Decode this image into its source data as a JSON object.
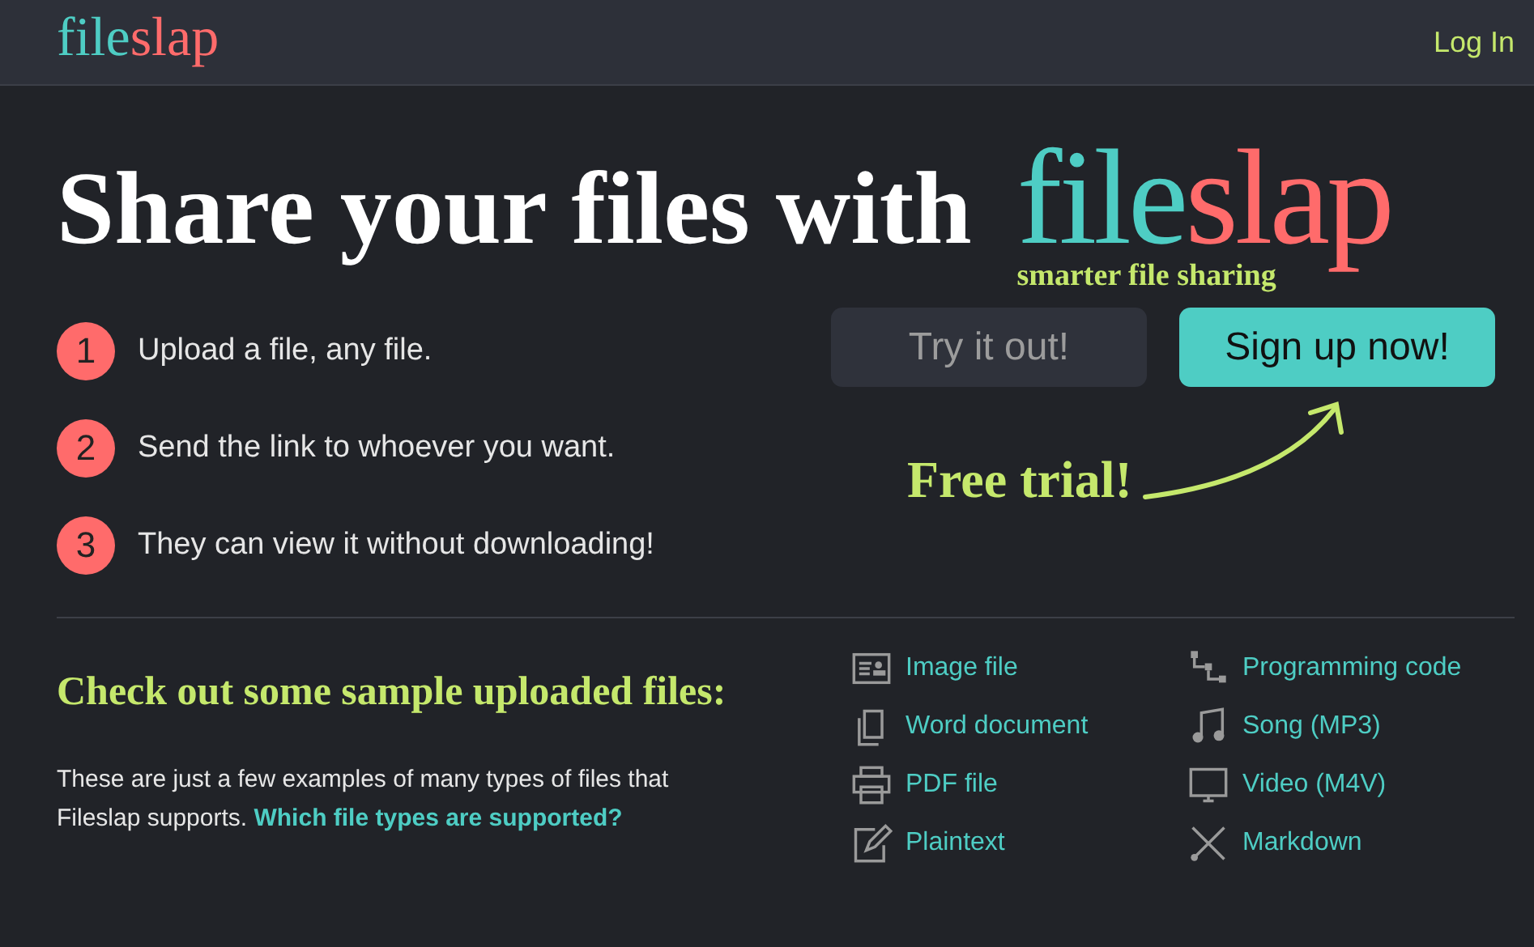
{
  "header": {
    "logo": [
      {
        "text": "file",
        "color": "#4ecdc4"
      },
      {
        "text": "slap",
        "color": "#ff6b6b"
      }
    ],
    "login": "Log In"
  },
  "hero": {
    "headline": "Share your files with",
    "logo": [
      {
        "text": "file",
        "color": "#4ecdc4"
      },
      {
        "text": "slap",
        "color": "#ff6b6b"
      }
    ],
    "tagline": "smarter file sharing"
  },
  "steps": [
    {
      "number": "1",
      "text": "Upload a file, any file."
    },
    {
      "number": "2",
      "text": "Send the link to whoever you want."
    },
    {
      "number": "3",
      "text": "They can view it without downloading!"
    }
  ],
  "buttons": [
    {
      "label": "Try it out!",
      "kind": "secondary"
    },
    {
      "label": "Sign up now!",
      "kind": "primary"
    }
  ],
  "callout": "Free trial!",
  "samples": {
    "heading": "Check out some sample uploaded files:",
    "description": "These are just a few examples of many types of files that Fileslap supports. ",
    "link": "Which file types are supported?",
    "files": [
      {
        "label": "Image file",
        "kind": "image"
      },
      {
        "label": "Programming code",
        "kind": "code"
      },
      {
        "label": "Word document",
        "kind": "document"
      },
      {
        "label": "Song (MP3)",
        "kind": "music"
      },
      {
        "label": "PDF file",
        "kind": "print"
      },
      {
        "label": "Video (M4V)",
        "kind": "video"
      },
      {
        "label": "Plaintext",
        "kind": "text"
      },
      {
        "label": "Markdown",
        "kind": "markdown"
      }
    ]
  }
}
